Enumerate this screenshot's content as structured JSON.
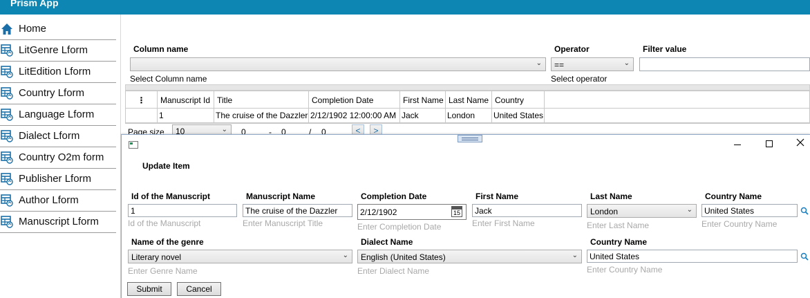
{
  "app": {
    "title": "Prism App"
  },
  "colors": {
    "titlebar": "#0e86b3",
    "icon": "#1a6fa8"
  },
  "sidebar": {
    "items": [
      {
        "label": "Home",
        "icon": "home-icon"
      },
      {
        "label": "LitGenre Lform",
        "icon": "table-edit-icon"
      },
      {
        "label": "LitEdition Lform",
        "icon": "table-edit-icon"
      },
      {
        "label": "Country Lform",
        "icon": "table-edit-icon"
      },
      {
        "label": "Language Lform",
        "icon": "table-edit-icon"
      },
      {
        "label": "Dialect Lform",
        "icon": "table-edit-icon"
      },
      {
        "label": "Country O2m form",
        "icon": "table-edit-icon"
      },
      {
        "label": "Publisher Lform",
        "icon": "table-edit-icon"
      },
      {
        "label": "Author Lform",
        "icon": "table-edit-icon"
      },
      {
        "label": "Manuscript Lform",
        "icon": "table-edit-icon"
      }
    ]
  },
  "filter": {
    "column_label": "Column name",
    "column_hint": "Select Column name",
    "column_value": "",
    "operator_label": "Operator",
    "operator_value": "==",
    "operator_hint": "Select operator",
    "value_label": "Filter value",
    "value_value": ""
  },
  "grid": {
    "menu_glyph": "⋮",
    "columns": [
      "Manuscript Id",
      "Title",
      "Completion Date",
      "First Name",
      "Last Name",
      "Country"
    ],
    "rows": [
      [
        "1",
        "The cruise of the Dazzler",
        "2/12/1902 12:00:00 AM",
        "Jack",
        "London",
        "United States"
      ]
    ]
  },
  "pager": {
    "page_size_label": "Page size",
    "page_size_value": "10",
    "from": "0",
    "dash": "-",
    "to": "0",
    "slash": "/",
    "total": "0",
    "prev": "<",
    "next": ">"
  },
  "dialog": {
    "title": "Update Item",
    "fields": {
      "id": {
        "label": "Id of the Manuscript",
        "value": "1",
        "hint": "Id of the Manuscript"
      },
      "name": {
        "label": "Manuscript Name",
        "value": "The cruise of the Dazzler",
        "hint": "Enter Manuscript Title"
      },
      "date": {
        "label": "Completion Date",
        "value": "2/12/1902",
        "hint": "Enter Completion Date",
        "calendar_day": "15"
      },
      "first": {
        "label": "First Name",
        "value": "Jack",
        "hint": "Enter First Name"
      },
      "last": {
        "label": "Last Name",
        "value": "London",
        "hint": "Enter Last Name"
      },
      "country": {
        "label": "Country Name",
        "value": "United States",
        "hint": "Enter Country Name"
      },
      "genre": {
        "label": "Name of the genre",
        "value": "Literary novel",
        "hint": "Enter Genre Name"
      },
      "dialect": {
        "label": "Dialect Name",
        "value": "English (United States)",
        "hint": "Enter Dialect Name"
      },
      "country2": {
        "label": "Country Name",
        "value": "United States",
        "hint": "Enter Country Name"
      }
    },
    "submit_label": "Submit",
    "cancel_label": "Cancel"
  }
}
